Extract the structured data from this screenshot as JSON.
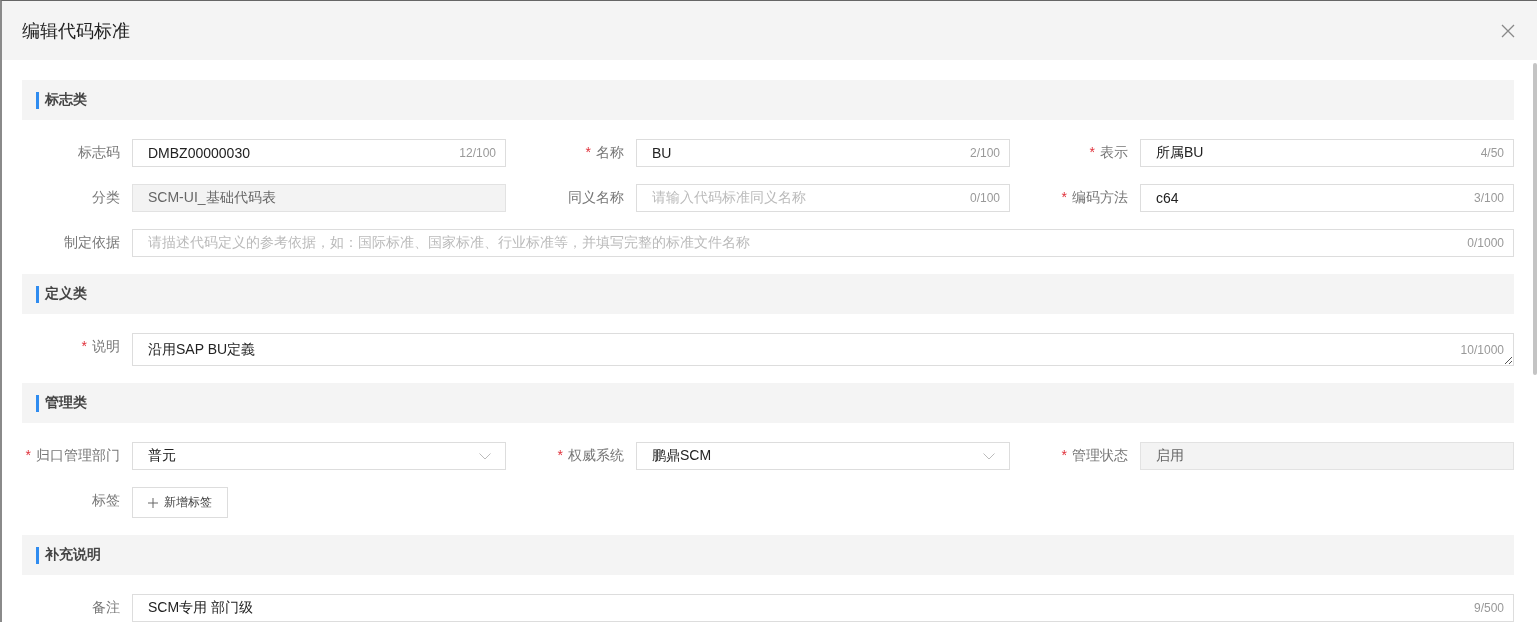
{
  "dialog": {
    "title": "编辑代码标准"
  },
  "sections": [
    {
      "title": "标志类",
      "rows": [
        [
          {
            "kind": "input",
            "label": "标志码",
            "disabled": false,
            "value": "DMBZ00000030",
            "count": "12/100"
          },
          {
            "kind": "input",
            "required_mark": "*",
            "label": "名称",
            "disabled": false,
            "value": "BU",
            "count": "2/100"
          },
          {
            "kind": "input",
            "required_mark": "*",
            "label": "表示",
            "disabled": false,
            "value": "所属BU",
            "count": "4/50"
          }
        ],
        [
          {
            "kind": "input",
            "label": "分类",
            "disabled": true,
            "value": "SCM-UI_基础代码表"
          },
          {
            "kind": "input",
            "label": "同义名称",
            "disabled": false,
            "placeholder": "请输入代码标准同义名称",
            "count": "0/100"
          },
          {
            "kind": "input",
            "required_mark": "*",
            "label": "编码方法",
            "disabled": false,
            "value": "c64",
            "count": "3/100"
          }
        ],
        [
          {
            "kind": "input",
            "label": "制定依据",
            "disabled": false,
            "placeholder": "请描述代码定义的参考依据，如：国际标准、国家标准、行业标准等，并填写完整的标准文件名称",
            "count": "0/1000"
          }
        ]
      ]
    },
    {
      "title": "定义类",
      "rows": [
        [
          {
            "kind": "textarea",
            "required_mark": "*",
            "label": "说明",
            "disabled": false,
            "value": "沿用SAP BU定義",
            "count": "10/1000"
          }
        ]
      ]
    },
    {
      "title": "管理类",
      "rows": [
        [
          {
            "kind": "select",
            "required_mark": "*",
            "label": "归口管理部门",
            "disabled": false,
            "value": "普元"
          },
          {
            "kind": "select",
            "required_mark": "*",
            "label": "权威系统",
            "disabled": false,
            "value": "鹏鼎SCM"
          },
          {
            "kind": "input",
            "required_mark": "*",
            "label": "管理状态",
            "disabled": true,
            "value": "启用"
          }
        ],
        [
          {
            "kind": "button",
            "label": "标签",
            "value": "新增标签"
          }
        ]
      ]
    },
    {
      "title": "补充说明",
      "rows": [
        [
          {
            "kind": "input",
            "label": "备注",
            "disabled": false,
            "value": "SCM专用 部门级",
            "count": "9/500"
          }
        ]
      ]
    }
  ]
}
